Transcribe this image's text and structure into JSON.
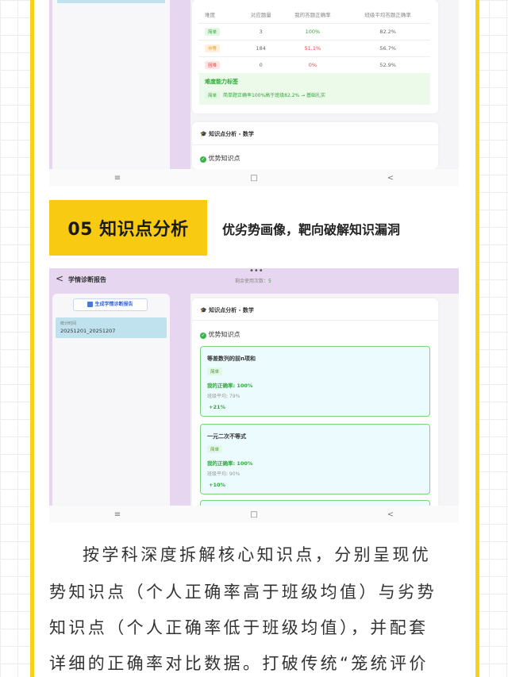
{
  "top_shot": {
    "table_headers": [
      "难度",
      "对应题量",
      "我的答题正确率",
      "班级平均答题正确率"
    ],
    "rows": [
      {
        "level": "简单",
        "count": "3",
        "mine": "100%",
        "class_avg": "82.2%"
      },
      {
        "level": "中等",
        "count": "184",
        "mine": "51.1%",
        "class_avg": "56.7%"
      },
      {
        "level": "困难",
        "count": "0",
        "mine": "0%",
        "class_avg": "52.9%"
      }
    ],
    "ability_title": "难度能力标签",
    "ability_tag": "简单",
    "ability_text": "简单题正确率100%高于班级82.2% → 基础扎实",
    "kp_header": "知识点分析 - 数学",
    "kp_section": "优势知识点"
  },
  "nav": {
    "menu": "≡",
    "home": "□",
    "back": "<"
  },
  "section": {
    "badge": "05 知识点分析",
    "subtitle": "优劣势画像，靶向破解知识漏洞"
  },
  "bottom_shot": {
    "header_title": "学情诊断报告",
    "remaining_label": "剩余使用次数：",
    "remaining_value": "5",
    "generate_button": "生成学情诊断报告",
    "period_label": "统计时间",
    "period_value": "20251201_20251207",
    "kp_header": "知识点分析 - 数学",
    "kp_section": "优势知识点",
    "cards": [
      {
        "title": "等差数列的前n项和",
        "tag": "简单",
        "rate": "我的正确率: 100%",
        "avg": "班级平均: 79%",
        "diff": "+21%"
      },
      {
        "title": "一元二次不等式",
        "tag": "简单",
        "rate": "我的正确率: 100%",
        "avg": "班级平均: 90%",
        "diff": "+10%"
      }
    ]
  },
  "paragraph": [
    "按学科深度拆解核心知识点，分别呈现优",
    "势知识点（个人正确率高于班级均值）与劣势",
    "知识点（个人正确率低于班级均值），并配套",
    "详细的正确率对比数据。打破传统“笼统评价"
  ],
  "colors": {
    "accent": "#f8ca12",
    "green": "#2fa83a",
    "red": "#e24848",
    "lilac": "#e6d6f0"
  }
}
